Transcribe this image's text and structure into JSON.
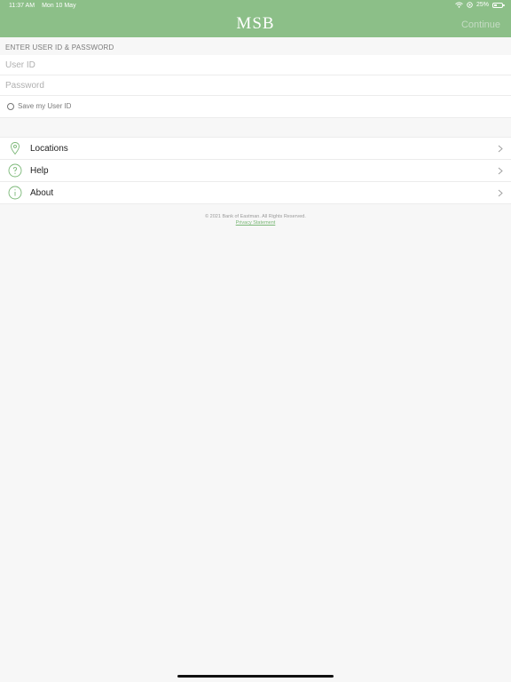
{
  "status": {
    "time": "11:37 AM",
    "date": "Mon 10 May",
    "battery": "25%",
    "icons": [
      "wifi-icon",
      "location-icon",
      "battery-icon"
    ]
  },
  "header": {
    "logo": "MSB",
    "continue_label": "Continue",
    "color": "#8cbf88"
  },
  "login": {
    "section_label": "ENTER USER ID & PASSWORD",
    "user_id_placeholder": "User ID",
    "password_placeholder": "Password",
    "save_label": "Save my User ID"
  },
  "menu": {
    "items": [
      {
        "label": "Locations",
        "icon": "location-pin-icon"
      },
      {
        "label": "Help",
        "icon": "question-icon"
      },
      {
        "label": "About",
        "icon": "info-icon"
      }
    ]
  },
  "footer": {
    "copyright": "© 2021 Bank of Eastman. All Rights Reserved.",
    "privacy_link": "Privacy Statement"
  }
}
